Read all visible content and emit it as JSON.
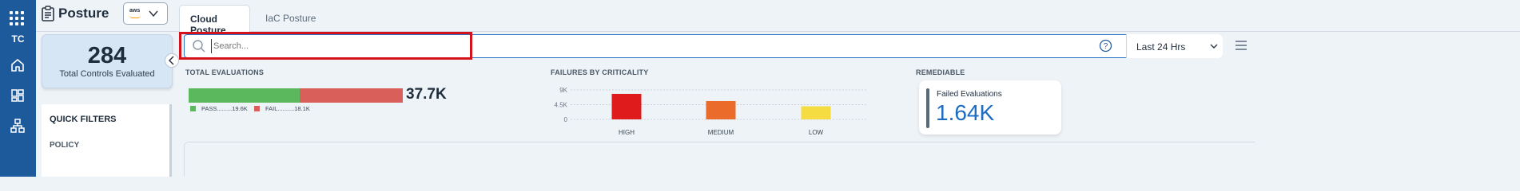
{
  "nav": {
    "workspace": "TC",
    "apps_icon": "apps-grid-icon",
    "items": [
      "home-icon",
      "dashboard-icon",
      "hierarchy-icon"
    ]
  },
  "header": {
    "title": "Posture",
    "cloud_provider": "aws",
    "tabs": [
      {
        "label": "Cloud Posture",
        "active": true
      },
      {
        "label": "IaC Posture",
        "active": false
      }
    ]
  },
  "summary": {
    "total_controls": "284",
    "total_controls_label": "Total Controls Evaluated"
  },
  "quick_filters": {
    "title": "QUICK FILTERS",
    "first_item": "POLICY"
  },
  "search": {
    "placeholder": "Search...",
    "value": ""
  },
  "time_range": {
    "selected": "Last 24 Hrs"
  },
  "total_evaluations": {
    "title": "TOTAL EVALUATIONS",
    "total": "37.7K",
    "pass_label": "PASS.........19.6K",
    "fail_label": "FAIL..........18.1K",
    "pass_value": 19.6,
    "fail_value": 18.1,
    "colors": {
      "pass": "#5cb85c",
      "fail": "#d9605a"
    }
  },
  "failures_by_criticality": {
    "title": "FAILURES BY CRITICALITY"
  },
  "chart_data": {
    "type": "bar",
    "title": "FAILURES BY CRITICALITY",
    "categories": [
      "HIGH",
      "MEDIUM",
      "LOW"
    ],
    "values": [
      7800,
      5600,
      4000
    ],
    "colors": [
      "#e01b1b",
      "#ea6b2a",
      "#f5dc40"
    ],
    "yticks": [
      "9K",
      "4.5K",
      "0"
    ],
    "ylim": [
      0,
      9000
    ],
    "grid": true
  },
  "remediable": {
    "title": "REMEDIABLE",
    "label": "Failed Evaluations",
    "value": "1.64K"
  }
}
